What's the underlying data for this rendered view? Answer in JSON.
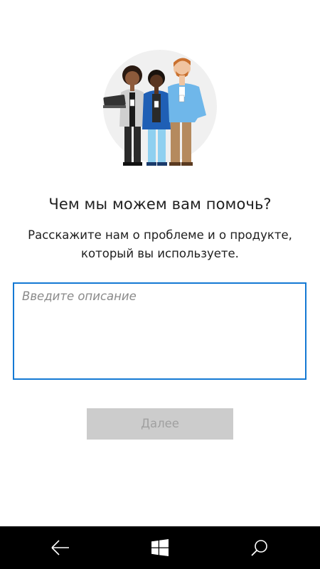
{
  "help": {
    "title": "Чем мы можем вам помочь?",
    "subtitle": "Расскажите нам о проблеме и о продукте, который вы используете.",
    "description_placeholder": "Введите описание",
    "description_value": "",
    "next_label": "Далее"
  },
  "navbar": {
    "icons": [
      "back-icon",
      "windows-start-icon",
      "search-icon"
    ]
  },
  "colors": {
    "accent": "#1479d4",
    "button_disabled_bg": "#cccccc",
    "button_disabled_text": "#a0a0a0",
    "navbar_bg": "#000000"
  }
}
